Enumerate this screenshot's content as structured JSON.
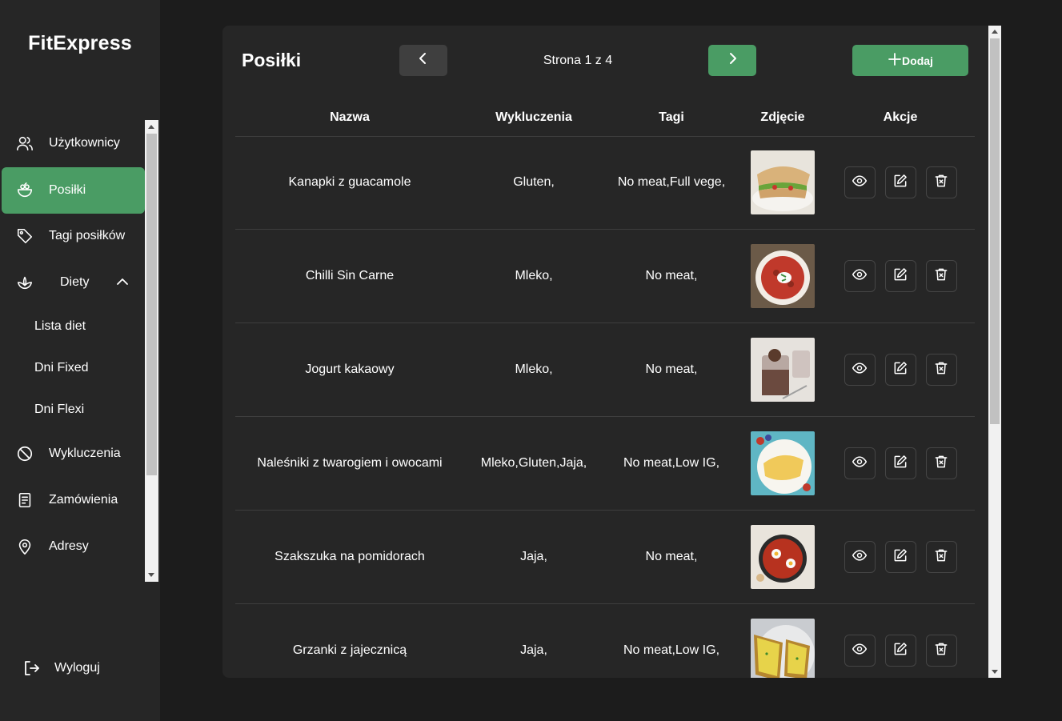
{
  "app": {
    "brand": "FitExpress"
  },
  "sidebar": {
    "items": [
      {
        "label": "Użytkownicy",
        "icon": "users-icon"
      },
      {
        "label": "Posiłki",
        "icon": "bowl-icon",
        "active": true
      },
      {
        "label": "Tagi posiłków",
        "icon": "tag-icon"
      },
      {
        "label": "Diety",
        "icon": "leaf-icon",
        "expanded": true
      },
      {
        "label": "Wykluczenia",
        "icon": "ban-icon"
      },
      {
        "label": "Zamówienia",
        "icon": "document-icon"
      },
      {
        "label": "Adresy",
        "icon": "location-pin-icon"
      }
    ],
    "sub_items": [
      {
        "label": "Lista diet"
      },
      {
        "label": "Dni Fixed"
      },
      {
        "label": "Dni Flexi"
      }
    ],
    "logout_label": "Wyloguj"
  },
  "main": {
    "title": "Posiłki",
    "page_info": "Strona 1 z 4",
    "add_label": "Dodaj",
    "columns": [
      "Nazwa",
      "Wykluczenia",
      "Tagi",
      "Zdjęcie",
      "Akcje"
    ],
    "rows": [
      {
        "name": "Kanapki z guacamole",
        "exclusions": "Gluten,",
        "tags": "No meat,Full vege,"
      },
      {
        "name": "Chilli Sin Carne",
        "exclusions": "Mleko,",
        "tags": "No meat,"
      },
      {
        "name": "Jogurt kakaowy",
        "exclusions": "Mleko,",
        "tags": "No meat,"
      },
      {
        "name": "Naleśniki z twarogiem i owocami",
        "exclusions": "Mleko,Gluten,Jaja,",
        "tags": "No meat,Low IG,"
      },
      {
        "name": "Szakszuka na pomidorach",
        "exclusions": "Jaja,",
        "tags": "No meat,"
      },
      {
        "name": "Grzanki z jajecznicą",
        "exclusions": "Jaja,",
        "tags": "No meat,Low IG,"
      }
    ]
  },
  "colors": {
    "accent": "#4a9c64",
    "sidebar_bg": "#262626",
    "page_bg": "#1c1c1c",
    "panel_bg": "#262626"
  }
}
